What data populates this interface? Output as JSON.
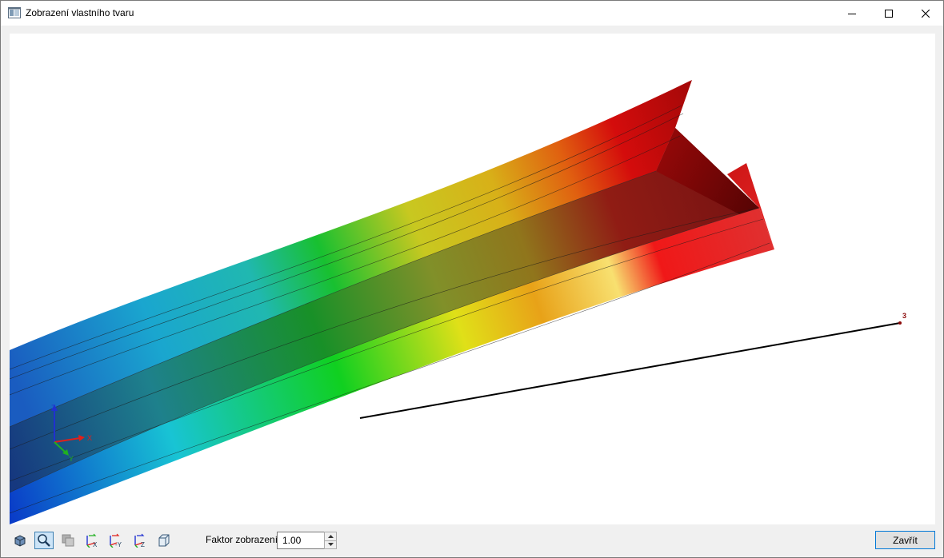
{
  "window": {
    "title": "Zobrazení vlastního tvaru",
    "controls": [
      "minimize-icon",
      "maximize-icon",
      "close-icon"
    ]
  },
  "viewport": {
    "node_label": "3",
    "axes": {
      "x": "X",
      "y": "Y",
      "z": "Z"
    },
    "axis_colors": {
      "x": "#e0201a",
      "y": "#20b020",
      "z": "#2030d0"
    },
    "contour_colors": [
      "#0a3cc8",
      "#12b8d0",
      "#12c82a",
      "#d8d818",
      "#e88a10",
      "#d80c0c",
      "#8c0a0a"
    ]
  },
  "toolbar": {
    "tools": [
      {
        "name": "iso-view-button",
        "icon": "iso-view-icon",
        "active": false
      },
      {
        "name": "zoom-button",
        "icon": "zoom-icon",
        "active": true
      },
      {
        "name": "render-mode-button",
        "icon": "render-mode-icon",
        "active": false,
        "disabled": true
      },
      {
        "name": "view-x-button",
        "icon": "view-x-icon",
        "label": "X"
      },
      {
        "name": "view-minus-y-button",
        "icon": "view-minus-y-icon",
        "label": "-Y"
      },
      {
        "name": "view-z-button",
        "icon": "view-z-icon",
        "label": "Z"
      },
      {
        "name": "box-view-button",
        "icon": "box-view-icon"
      }
    ],
    "factor_label": "Faktor zobrazení:",
    "factor_value": "1.00",
    "close_label": "Zavřít"
  }
}
